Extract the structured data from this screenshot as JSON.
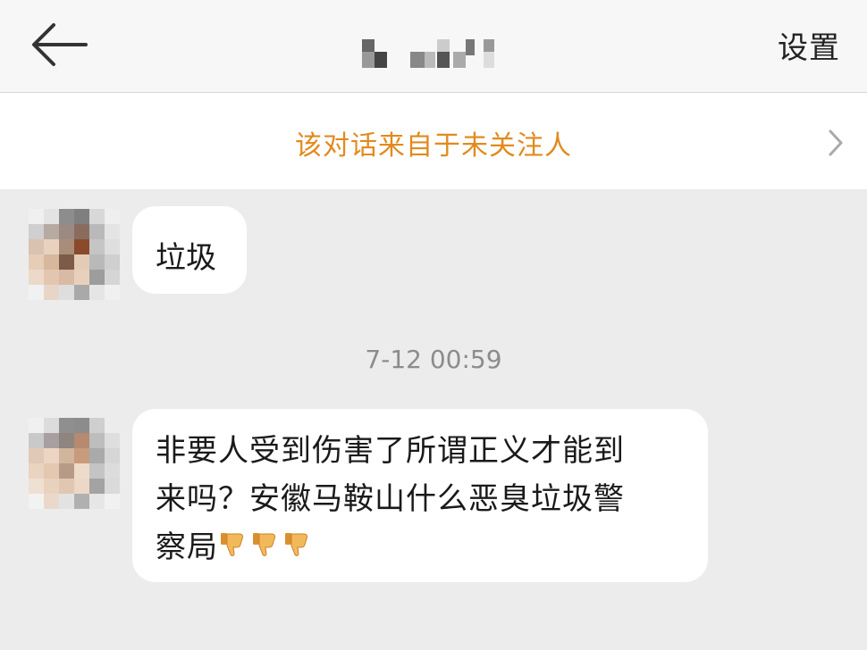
{
  "header": {
    "back_icon": "arrow-left-icon",
    "title_hidden": true,
    "settings_label": "设置"
  },
  "notice": {
    "text": "该对话来自于未关注人",
    "color": "#e28a1e",
    "chevron_icon": "chevron-right-icon"
  },
  "messages": [
    {
      "sender": "other",
      "text": "垃圾"
    },
    {
      "type": "timestamp",
      "text": "7-12 00:59"
    },
    {
      "sender": "other",
      "text": "非要人受到伤害了所谓正义才能到来吗？安徽马鞍山什么恶臭垃圾警察局",
      "lines": [
        "非要人受到伤害了所谓正义才能到",
        "来吗？安徽马鞍山什么恶臭垃圾警",
        "察局"
      ],
      "emoji": [
        "thumbs-down-emoji",
        "thumbs-down-emoji",
        "thumbs-down-emoji"
      ]
    }
  ],
  "colors": {
    "background": "#ececec",
    "bubble": "#ffffff",
    "accent": "#e28a1e"
  }
}
